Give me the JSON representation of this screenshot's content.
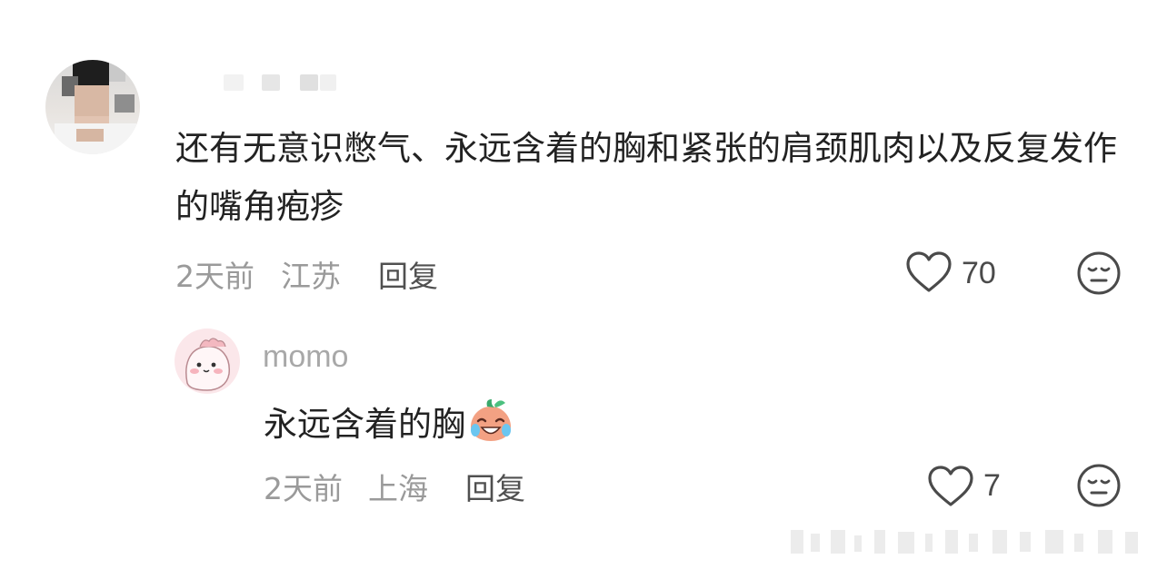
{
  "comment": {
    "text": "还有无意识憋气、永远含着的胸和紧张的肩颈肌肉以及反复发作的嘴角疱疹",
    "time": "2天前",
    "location": "江苏",
    "reply_label": "回复",
    "likes": "70",
    "like_icon": "heart-outline-icon",
    "reaction_icon": "meh-face-icon"
  },
  "reply": {
    "username": "momo",
    "text": "永远含着的胸",
    "emoji_icon": "crying-laughing-peach-emoji",
    "time": "2天前",
    "location": "上海",
    "reply_label": "回复",
    "likes": "7",
    "like_icon": "heart-outline-icon",
    "reaction_icon": "meh-face-icon"
  }
}
